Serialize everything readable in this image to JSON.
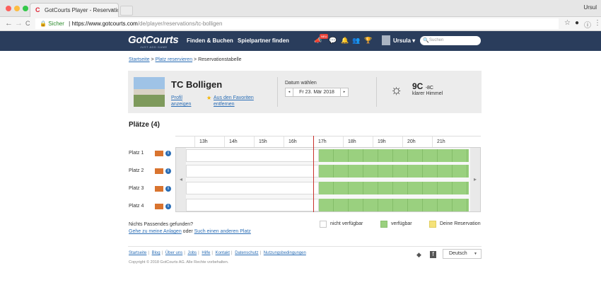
{
  "browser": {
    "tab_title": "GotCourts Player - Reservatio",
    "tab_favicon": "C",
    "tab_close": "×",
    "user": "Ursul",
    "secure_label": "Sicher",
    "url_domain": "https://www.gotcourts.com",
    "url_path": "/de/player/reservations/tc-bolligen",
    "back_icon": "←",
    "forward_icon": "→",
    "reload_icon": "C",
    "lock_icon": "🔒",
    "star_icon": "☆",
    "ext_icon": "●",
    "info_icon": "ⓘ",
    "menu_icon": "⋮"
  },
  "header": {
    "logo": "GotCourts",
    "logo_sub": "JUST ADD GAME",
    "nav": [
      "Finden & Buchen",
      "Spielpartner finden"
    ],
    "badge": "NEU",
    "icons": [
      "📣",
      "💬",
      "🔔",
      "👥",
      "🏆"
    ],
    "user": "Ursula ▾",
    "search_placeholder": "Suchen",
    "search_icon": "🔍"
  },
  "breadcrumb": {
    "home": "Startseite",
    "sep1": " > ",
    "reserve": "Platz reservieren",
    "sep2": " > ",
    "current": "Reservationstabelle"
  },
  "club": {
    "name": "TC Bolligen",
    "profile_link_1": "Profil",
    "profile_link_2": "anzeigen",
    "fav_star": "★",
    "fav_link_1": "Aus den Favoriten",
    "fav_link_2": "entfernen",
    "date_label": "Datum wählen",
    "date_prev": "◂",
    "date_next": "▸",
    "date_value": "Fr 23. Mär 2018",
    "weather_icon": "☼",
    "temp_high": "9C",
    "temp_low": "-8C",
    "weather_desc": "klarer Himmel"
  },
  "courts": {
    "title": "Plätze (4)",
    "hours": [
      "13h",
      "14h",
      "15h",
      "16h",
      "17h",
      "18h",
      "19h",
      "20h",
      "21h"
    ],
    "rows": [
      {
        "label": "Platz 1",
        "info": "i"
      },
      {
        "label": "Platz 2",
        "info": "i"
      },
      {
        "label": "Platz 3",
        "info": "i"
      },
      {
        "label": "Platz 4",
        "info": "i"
      }
    ],
    "arrow_left": "◂",
    "arrow_right": "▸"
  },
  "notes": {
    "nothing": "Nichts Passendes gefunden?",
    "link1": "Gehe zu meine Anlagen",
    "middle": " oder ",
    "link2": "Such einen anderen Platz"
  },
  "legend": {
    "unavailable": "nicht verfügbar",
    "available": "verfügbar",
    "mine": "Deine Reservation",
    "colors": {
      "unavailable": "#ffffff",
      "available": "#9ad07f",
      "mine": "#f5e27a"
    }
  },
  "footer": {
    "links": [
      "Startseite",
      "Blog",
      "Über uns",
      "Jobs",
      "Hilfe",
      "Kontakt",
      "Datenschutz",
      "Nutzungsbedingungen"
    ],
    "sep": "|",
    "copyright": "Copyright © 2018 GotCourts AG. Alle Rechte vorbehalten.",
    "social": [
      "",
      "◆",
      "f"
    ],
    "language": "Deutsch",
    "language_caret": "▼"
  },
  "colors": {
    "header_bg": "#2a3d5c",
    "link": "#2a6db5",
    "now_line": "#c9302c"
  }
}
